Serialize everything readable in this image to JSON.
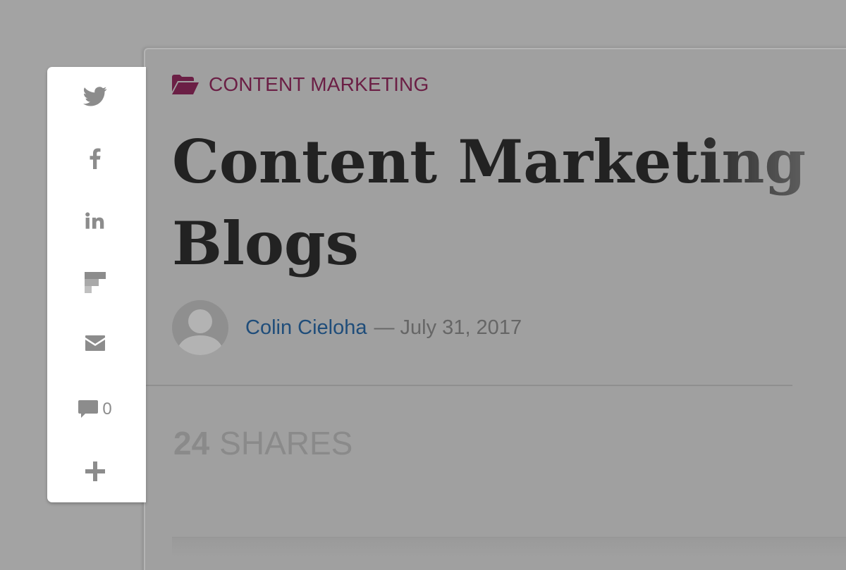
{
  "share_bar": {
    "buttons": [
      {
        "icon": "twitter-icon"
      },
      {
        "icon": "facebook-icon"
      },
      {
        "icon": "linkedin-icon"
      },
      {
        "icon": "flipboard-icon"
      },
      {
        "icon": "email-icon"
      },
      {
        "icon": "comment-icon",
        "count": "0"
      },
      {
        "icon": "plus-icon"
      }
    ]
  },
  "article": {
    "category": "CONTENT MARKETING",
    "title": "Content Marketing\nBlogs",
    "author": "Colin Cieloha",
    "date": "— July 31, 2017",
    "shares_count": "24",
    "shares_label": "SHARES"
  },
  "colors": {
    "category": "#6b1f45",
    "author_link": "#1f4d7a",
    "title": "#222222",
    "overlay_background": "#a3a3a3"
  }
}
